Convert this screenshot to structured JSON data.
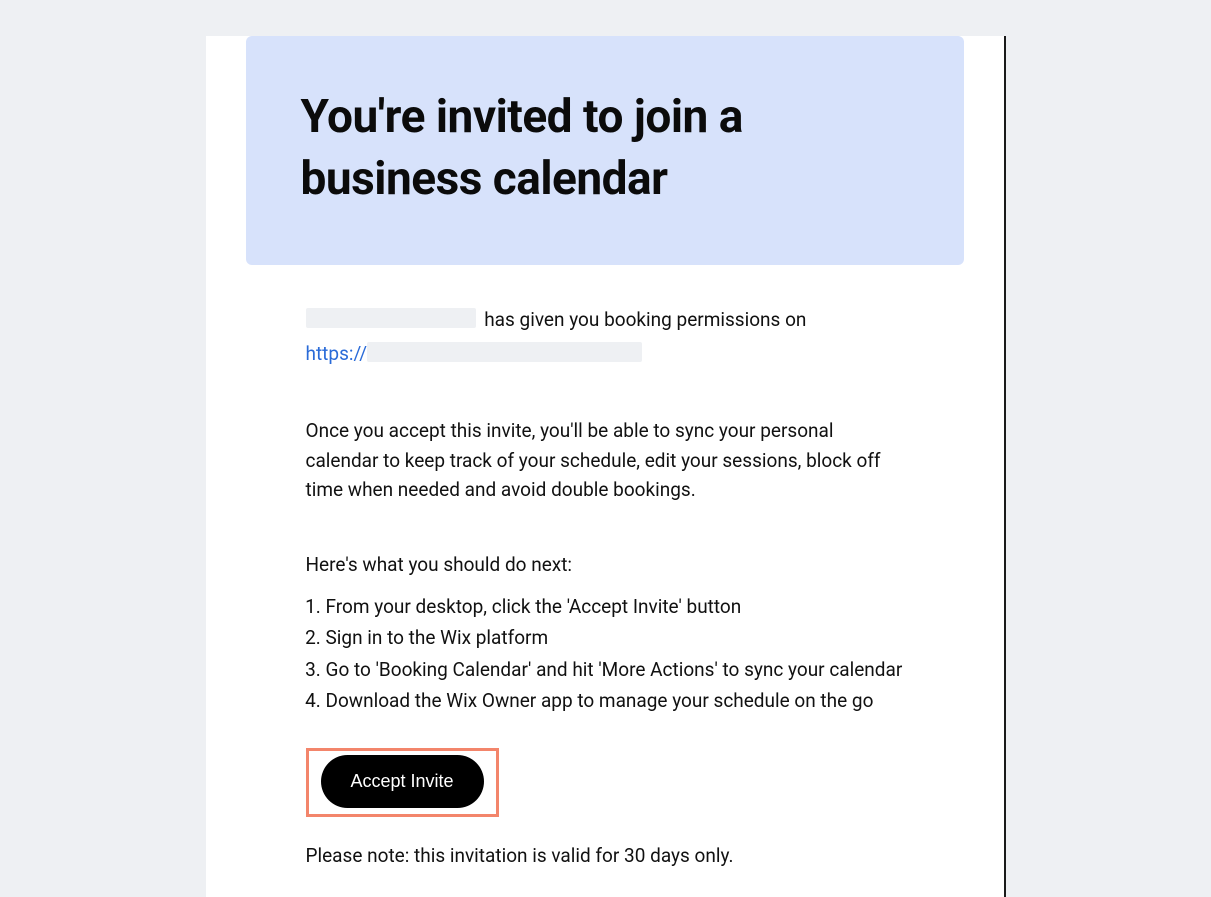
{
  "hero": {
    "title": "You're invited to join a business calendar"
  },
  "intro": {
    "after_name": "has given you booking permissions on",
    "link_prefix": "https://"
  },
  "description": "Once you accept this invite, you'll be able to sync your personal calendar to keep track of your schedule, edit your sessions, block off time when needed and avoid double bookings.",
  "next_lead": "Here's what you should do next:",
  "steps": [
    "From your desktop, click the 'Accept Invite' button",
    "Sign in to the Wix platform",
    "Go to 'Booking Calendar' and hit 'More Actions' to sync your calendar",
    "Download the Wix Owner app to manage your schedule on the go"
  ],
  "cta": {
    "label": "Accept Invite"
  },
  "note": "Please note: this invitation is valid for 30 days only."
}
